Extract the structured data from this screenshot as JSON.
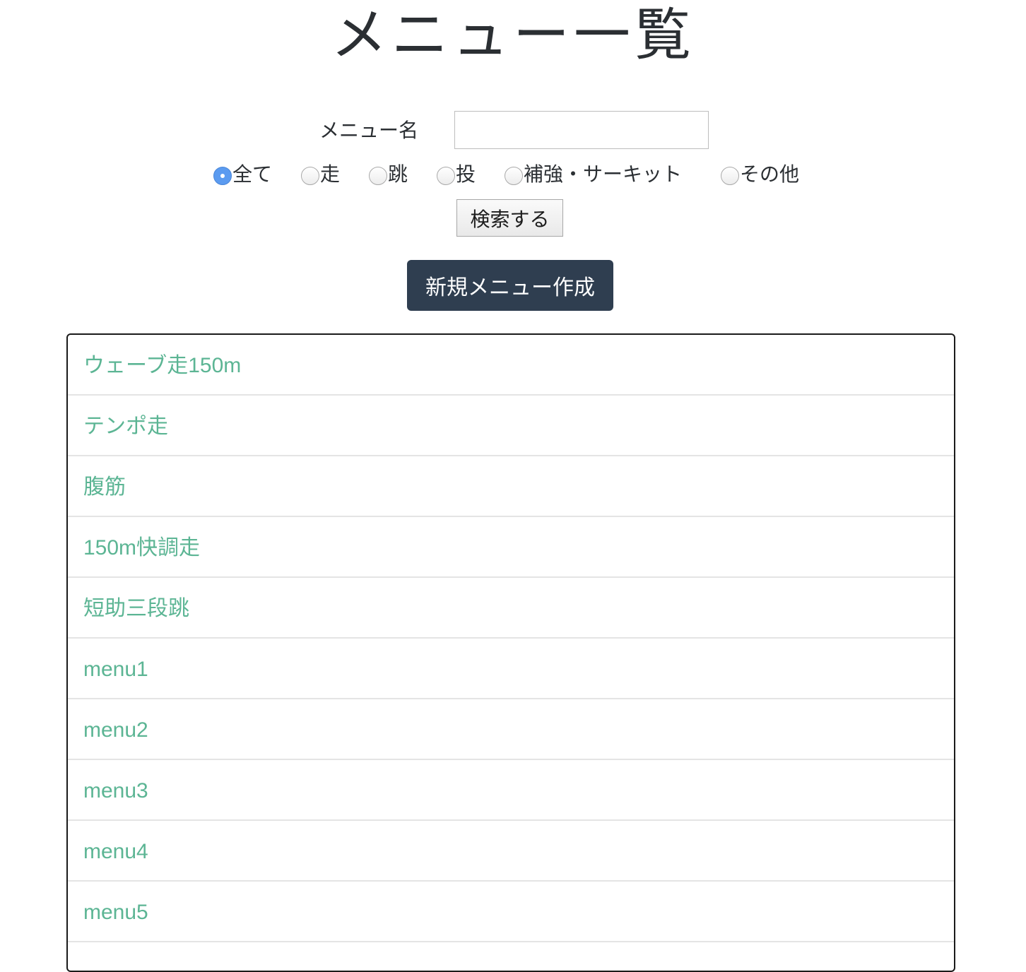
{
  "page": {
    "title": "メニュー一覧"
  },
  "search": {
    "label": "メニュー名",
    "value": "",
    "placeholder": "",
    "button_label": "検索する"
  },
  "categories": {
    "options": [
      {
        "label": "全て",
        "checked": true
      },
      {
        "label": "走",
        "checked": false
      },
      {
        "label": "跳",
        "checked": false
      },
      {
        "label": "投",
        "checked": false
      },
      {
        "label": "補強・サーキット",
        "checked": false
      },
      {
        "label": "その他",
        "checked": false
      }
    ]
  },
  "actions": {
    "new_menu_label": "新規メニュー作成"
  },
  "menus": {
    "items": [
      "ウェーブ走150m",
      "テンポ走",
      "腹筋",
      "150m快調走",
      "短助三段跳",
      "menu1",
      "menu2",
      "menu3",
      "menu4",
      "menu5"
    ]
  },
  "colors": {
    "link": "#5cb594",
    "primary_button": "#2f3e50",
    "radio_checked": "#5b9bf0"
  }
}
